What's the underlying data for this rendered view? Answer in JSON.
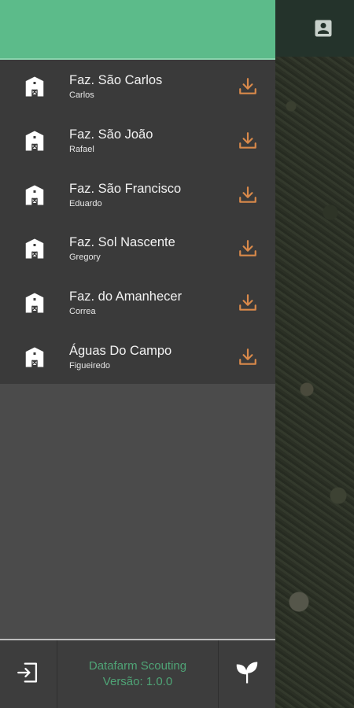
{
  "drawer": {
    "farms": [
      {
        "name": "Faz. São Carlos",
        "owner": "Carlos"
      },
      {
        "name": "Faz. São João",
        "owner": "Rafael"
      },
      {
        "name": "Faz. São Francisco",
        "owner": "Eduardo"
      },
      {
        "name": "Faz. Sol Nascente",
        "owner": "Gregory"
      },
      {
        "name": "Faz. do Amanhecer",
        "owner": "Correa"
      },
      {
        "name": "Águas Do Campo",
        "owner": "Figueiredo"
      }
    ]
  },
  "footer": {
    "app_name": "Datafarm Scouting",
    "version": "Versão: 1.0.0"
  },
  "icons": {
    "profile": "account-box-icon",
    "farm": "barn-icon",
    "download": "download-icon",
    "logout": "logout-icon",
    "brand": "sprout-icon"
  },
  "colors": {
    "header": "#5cbb8a",
    "accent_orange": "#d9894a",
    "version_text": "#4fa476"
  }
}
